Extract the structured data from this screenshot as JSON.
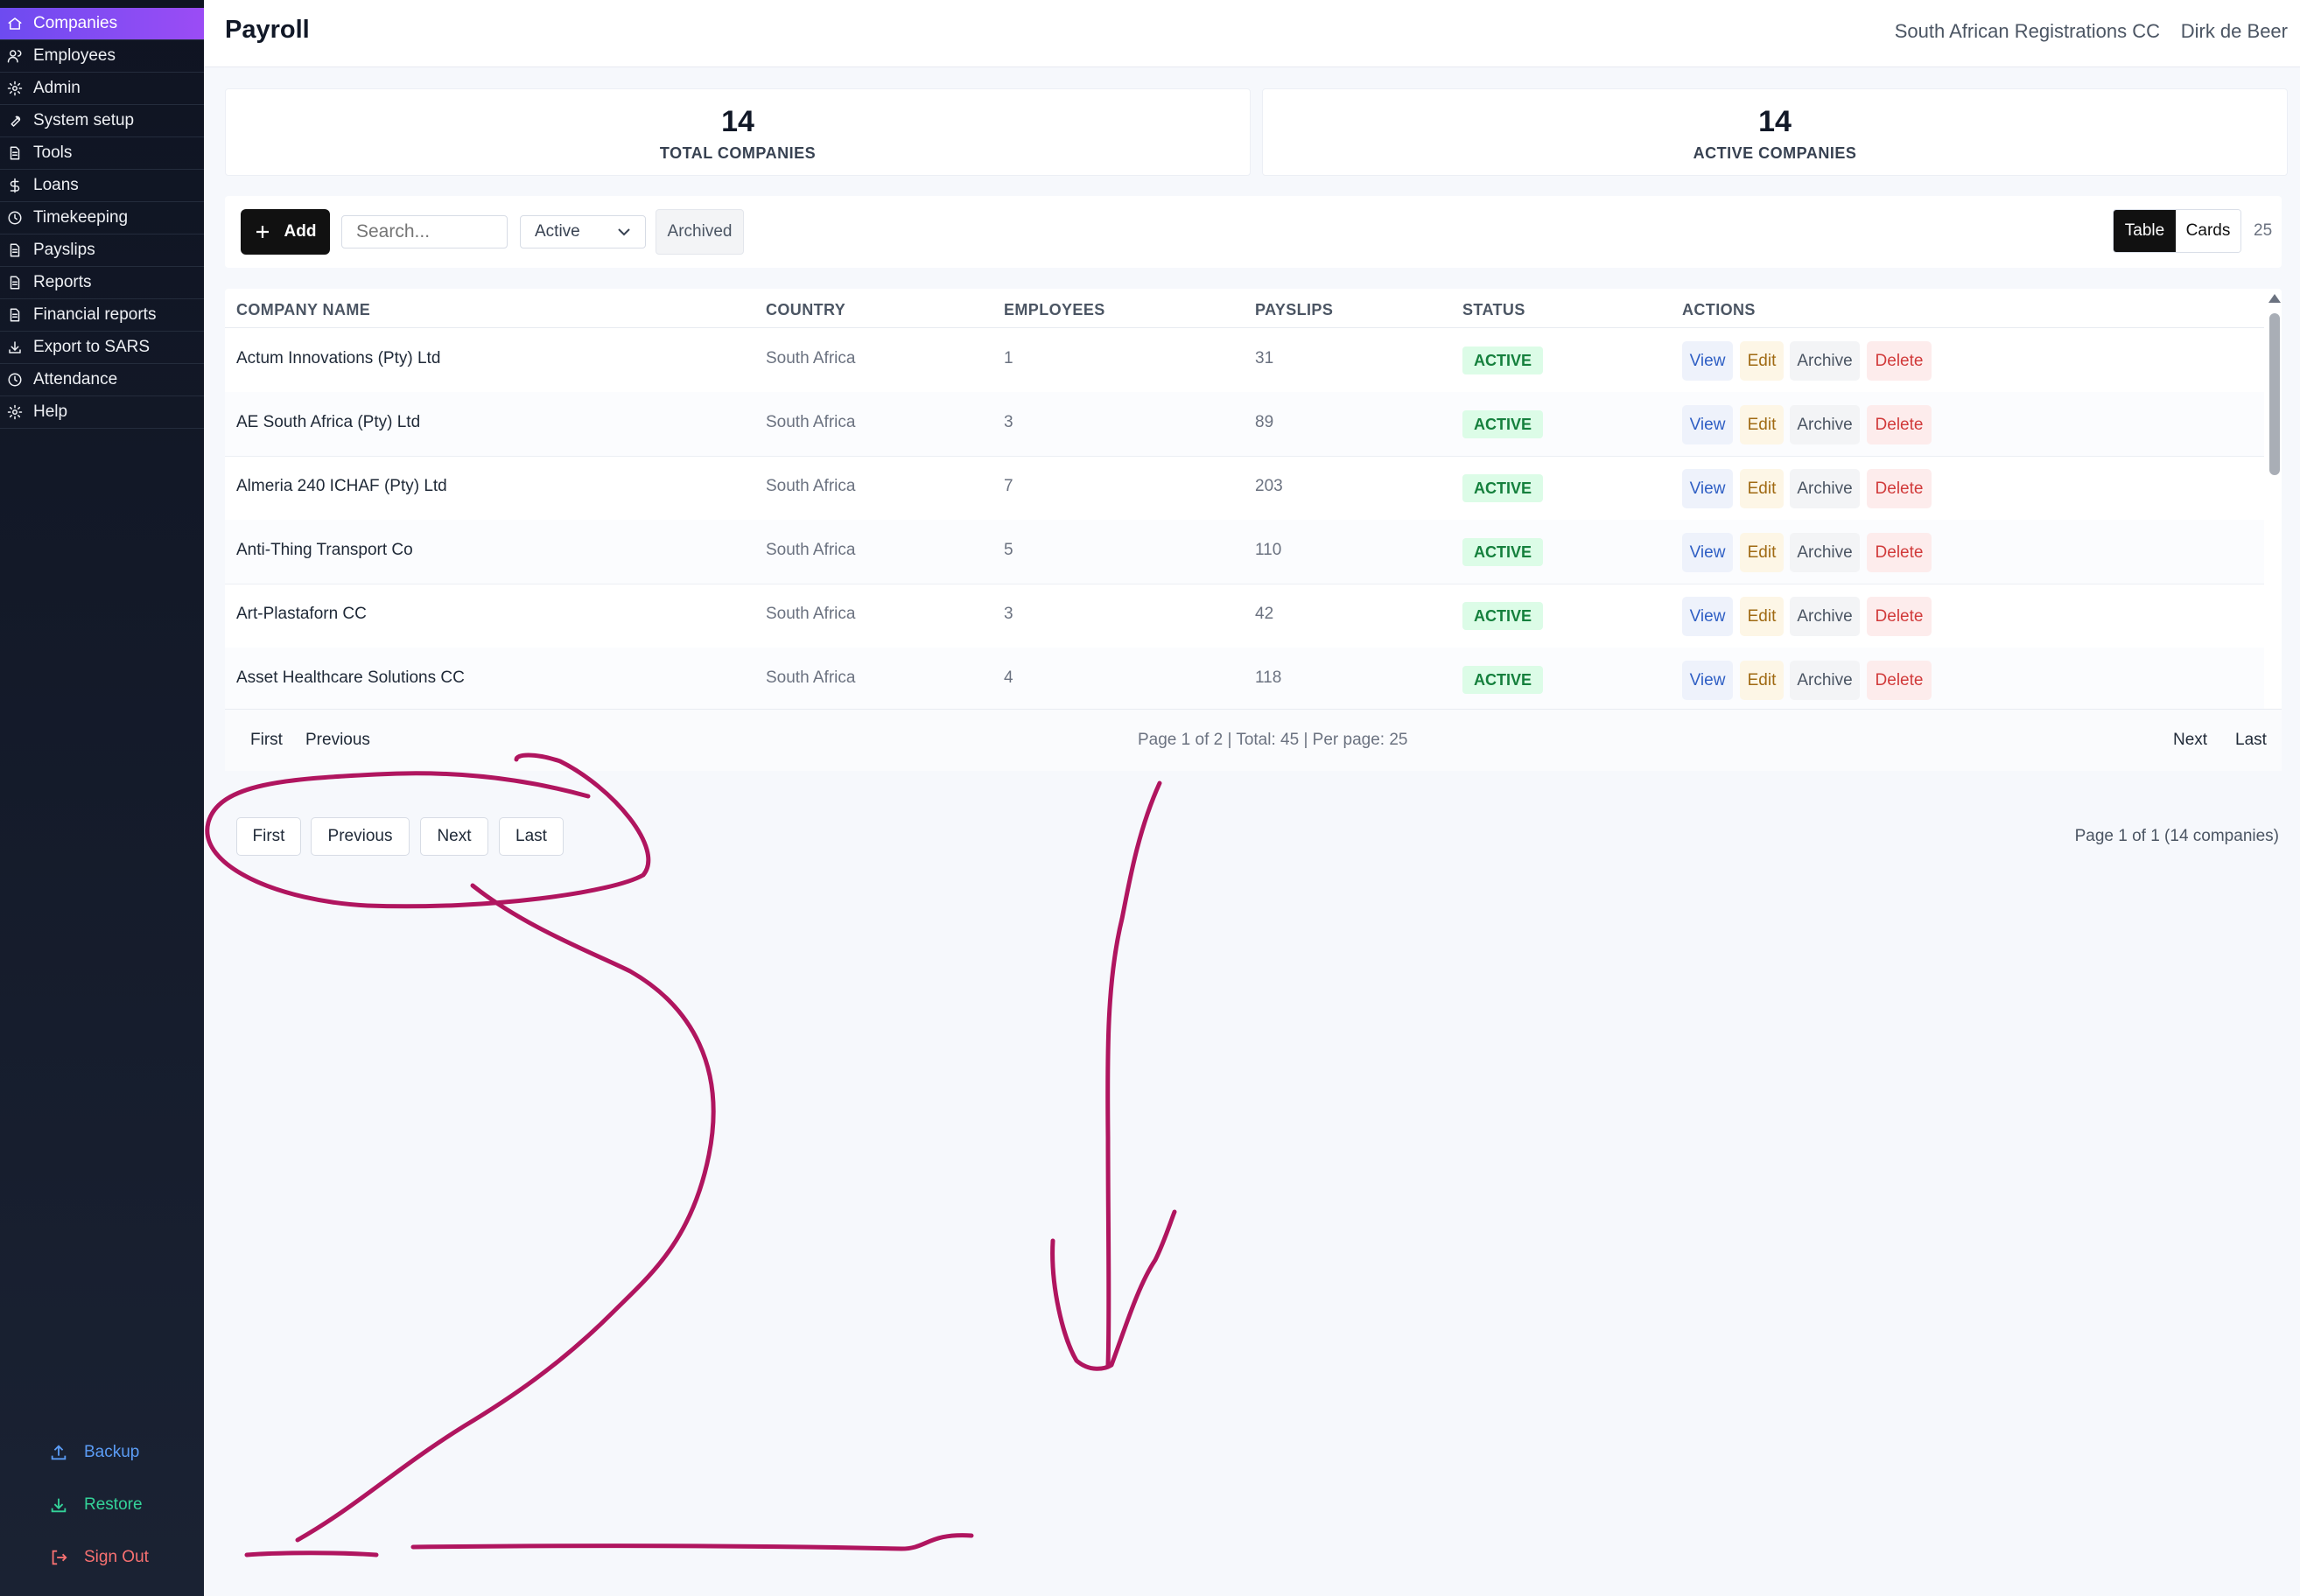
{
  "sidebar": {
    "items": [
      {
        "label": "Companies",
        "icon": "home-icon",
        "active": true
      },
      {
        "label": "Employees",
        "icon": "users-icon"
      },
      {
        "label": "Admin",
        "icon": "gear-icon"
      },
      {
        "label": "System setup",
        "icon": "wrench-icon"
      },
      {
        "label": "Tools",
        "icon": "document-icon"
      },
      {
        "label": "Loans",
        "icon": "dollar-icon"
      },
      {
        "label": "Timekeeping",
        "icon": "clock-icon"
      },
      {
        "label": "Payslips",
        "icon": "document-icon"
      },
      {
        "label": "Reports",
        "icon": "document-icon"
      },
      {
        "label": "Financial reports",
        "icon": "document-icon"
      },
      {
        "label": "Export to SARS",
        "icon": "download-icon"
      },
      {
        "label": "Attendance",
        "icon": "clock-icon"
      },
      {
        "label": "Help",
        "icon": "gear-icon"
      }
    ],
    "backup_label": "Backup",
    "restore_label": "Restore",
    "signout_label": "Sign Out",
    "colors": {
      "active_start": "#6d4bf0",
      "active_end": "#9b4cf5",
      "backup": "#5b9cf5",
      "restore": "#34d399",
      "signout": "#f87171"
    }
  },
  "header": {
    "title": "Payroll",
    "org": "South African Registrations CC",
    "user": "Dirk de Beer"
  },
  "stats": {
    "total": {
      "value": "14",
      "label": "TOTAL COMPANIES"
    },
    "active": {
      "value": "14",
      "label": "ACTIVE COMPANIES"
    }
  },
  "toolbar": {
    "add_label": "Add",
    "search_placeholder": "Search...",
    "status_selected": "Active",
    "archived_label": "Archived",
    "view_table": "Table",
    "view_cards": "Cards",
    "per_page": "25"
  },
  "table": {
    "headers": [
      "COMPANY NAME",
      "COUNTRY",
      "EMPLOYEES",
      "PAYSLIPS",
      "STATUS",
      "ACTIONS"
    ],
    "rows": [
      {
        "name": "Actum Innovations (Pty) Ltd",
        "country": "South Africa",
        "employees": "1",
        "payslips": "31",
        "status": "ACTIVE"
      },
      {
        "name": "AE South Africa (Pty) Ltd",
        "country": "South Africa",
        "employees": "3",
        "payslips": "89",
        "status": "ACTIVE"
      },
      {
        "name": "Almeria 240 ICHAF (Pty) Ltd",
        "country": "South Africa",
        "employees": "7",
        "payslips": "203",
        "status": "ACTIVE"
      },
      {
        "name": "Anti-Thing Transport Co",
        "country": "South Africa",
        "employees": "5",
        "payslips": "110",
        "status": "ACTIVE"
      },
      {
        "name": "Art-Plastaforn CC",
        "country": "South Africa",
        "employees": "3",
        "payslips": "42",
        "status": "ACTIVE"
      },
      {
        "name": "Asset Healthcare Solutions CC",
        "country": "South Africa",
        "employees": "4",
        "payslips": "118",
        "status": "ACTIVE"
      }
    ],
    "actions": {
      "view": "View",
      "edit": "Edit",
      "archive": "Archive",
      "delete": "Delete"
    }
  },
  "pager": {
    "first": "First",
    "previous": "Previous",
    "next": "Next",
    "last": "Last",
    "info": "Page 1 of 2 | Total: 45 | Per page: 25"
  },
  "pager2": {
    "first": "First",
    "previous": "Previous",
    "next": "Next",
    "last": "Last",
    "info": "Page 1 of 1 (14 companies)"
  },
  "annotation_color": "#b0155f"
}
